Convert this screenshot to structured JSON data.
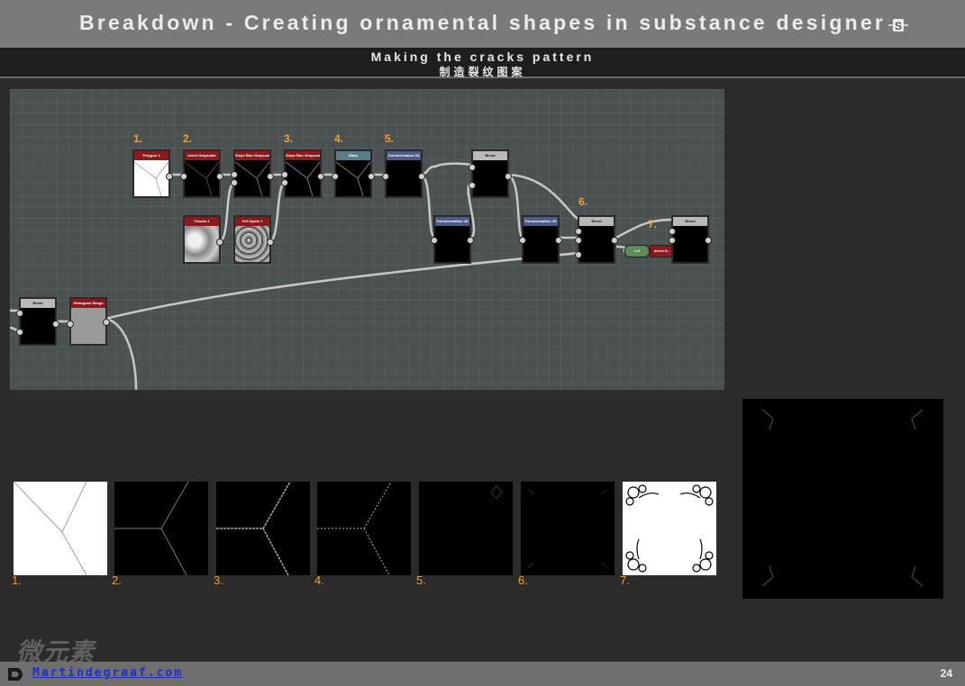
{
  "header": {
    "title": "Breakdown - Creating ornamental shapes in substance designer",
    "logo_icon": "substance-designer-icon"
  },
  "subheader": {
    "line1": "Making the cracks pattern",
    "line2": "制造裂纹图案"
  },
  "graph": {
    "step_labels": [
      "1.",
      "2.",
      "3.",
      "4.",
      "5.",
      "6.",
      "7."
    ],
    "nodes": {
      "polygon": "Polygon 1",
      "invert": "Invert Grayscale",
      "slope1": "Slope Blur Grayscale",
      "slope2": "Slope Blur Grayscale",
      "warp": "Warp",
      "transform1": "Transformation 2D",
      "blend1": "Blend",
      "transform2": "Transformation 2D",
      "transform3": "Transformation 2D",
      "blend2": "Blend",
      "lvl": "Lvl",
      "invert2": "Invert G...",
      "blend3": "Blend",
      "clouds": "Clouds 2",
      "grit": "Grit Spots 1",
      "blend_left": "Blend",
      "histogram": "Histogram Range"
    }
  },
  "thumbnails": {
    "labels": [
      "1.",
      "2.",
      "3.",
      "4.",
      "5.",
      "6.",
      "7."
    ]
  },
  "footer": {
    "website": "Martindegraaf.com",
    "page_number": "24",
    "watermark": "微元素"
  },
  "colors": {
    "accent_orange": "#f0a030",
    "header_gray": "#7a7a7a",
    "graph_bg": "#4a5150",
    "node_red": "#8b1a1f",
    "node_blue": "#4d5c86",
    "link_blue": "#1a2fd0"
  }
}
